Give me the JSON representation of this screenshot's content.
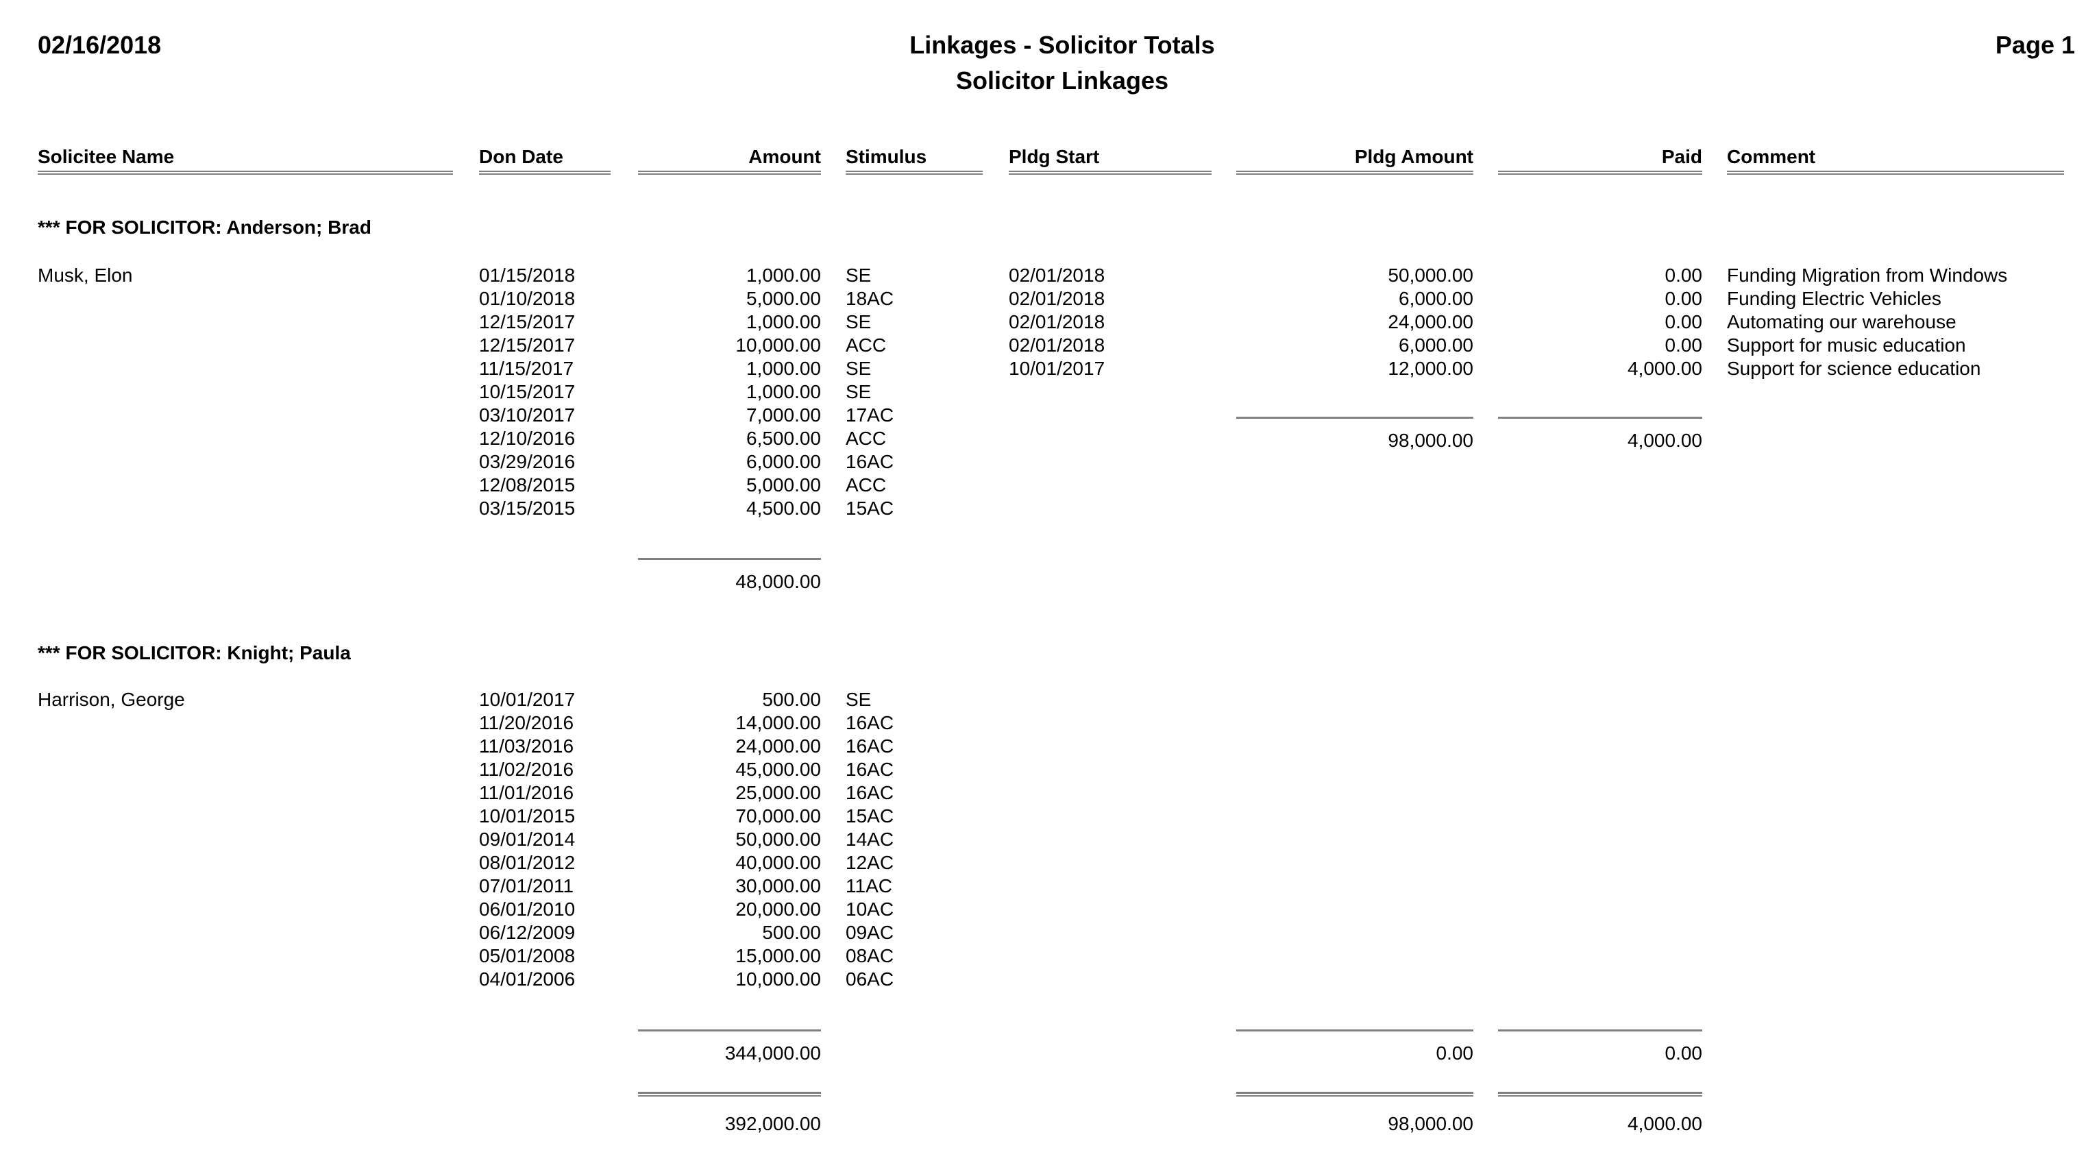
{
  "report": {
    "date": "02/16/2018",
    "title": "Linkages - Solicitor Totals",
    "subtitle": "Solicitor Linkages",
    "page": "Page 1"
  },
  "columns": {
    "solicitee_name": "Solicitee Name",
    "don_date": "Don Date",
    "amount": "Amount",
    "stimulus": "Stimulus",
    "pldg_start": "Pldg Start",
    "pldg_amount": "Pldg Amount",
    "paid": "Paid",
    "comment": "Comment"
  },
  "sections": [
    {
      "heading": "*** FOR SOLICITOR: Anderson; Brad",
      "solicitee": "Musk, Elon",
      "donations": [
        {
          "date": "01/15/2018",
          "amount": "1,000.00",
          "stimulus": "SE"
        },
        {
          "date": "01/10/2018",
          "amount": "5,000.00",
          "stimulus": "18AC"
        },
        {
          "date": "12/15/2017",
          "amount": "1,000.00",
          "stimulus": "SE"
        },
        {
          "date": "12/15/2017",
          "amount": "10,000.00",
          "stimulus": "ACC"
        },
        {
          "date": "11/15/2017",
          "amount": "1,000.00",
          "stimulus": "SE"
        },
        {
          "date": "10/15/2017",
          "amount": "1,000.00",
          "stimulus": "SE"
        },
        {
          "date": "03/10/2017",
          "amount": "7,000.00",
          "stimulus": "17AC"
        },
        {
          "date": "12/10/2016",
          "amount": "6,500.00",
          "stimulus": "ACC"
        },
        {
          "date": "03/29/2016",
          "amount": "6,000.00",
          "stimulus": "16AC"
        },
        {
          "date": "12/08/2015",
          "amount": "5,000.00",
          "stimulus": "ACC"
        },
        {
          "date": "03/15/2015",
          "amount": "4,500.00",
          "stimulus": "15AC"
        }
      ],
      "pledges": [
        {
          "start": "02/01/2018",
          "amount": "50,000.00",
          "paid": "0.00",
          "comment": "Funding Migration from Windows"
        },
        {
          "start": "02/01/2018",
          "amount": "6,000.00",
          "paid": "0.00",
          "comment": "Funding Electric Vehicles"
        },
        {
          "start": "02/01/2018",
          "amount": "24,000.00",
          "paid": "0.00",
          "comment": "Automating our warehouse"
        },
        {
          "start": "02/01/2018",
          "amount": "6,000.00",
          "paid": "0.00",
          "comment": "Support for music education"
        },
        {
          "start": "10/01/2017",
          "amount": "12,000.00",
          "paid": "4,000.00",
          "comment": "Support for science education"
        }
      ],
      "pledge_total": "98,000.00",
      "paid_total": "4,000.00",
      "amount_total": "48,000.00"
    },
    {
      "heading": "*** FOR SOLICITOR: Knight; Paula",
      "solicitee": "Harrison, George",
      "donations": [
        {
          "date": "10/01/2017",
          "amount": "500.00",
          "stimulus": "SE"
        },
        {
          "date": "11/20/2016",
          "amount": "14,000.00",
          "stimulus": "16AC"
        },
        {
          "date": "11/03/2016",
          "amount": "24,000.00",
          "stimulus": "16AC"
        },
        {
          "date": "11/02/2016",
          "amount": "45,000.00",
          "stimulus": "16AC"
        },
        {
          "date": "11/01/2016",
          "amount": "25,000.00",
          "stimulus": "16AC"
        },
        {
          "date": "10/01/2015",
          "amount": "70,000.00",
          "stimulus": "15AC"
        },
        {
          "date": "09/01/2014",
          "amount": "50,000.00",
          "stimulus": "14AC"
        },
        {
          "date": "08/01/2012",
          "amount": "40,000.00",
          "stimulus": "12AC"
        },
        {
          "date": "07/01/2011",
          "amount": "30,000.00",
          "stimulus": "11AC"
        },
        {
          "date": "06/01/2010",
          "amount": "20,000.00",
          "stimulus": "10AC"
        },
        {
          "date": "06/12/2009",
          "amount": "500.00",
          "stimulus": "09AC"
        },
        {
          "date": "05/01/2008",
          "amount": "15,000.00",
          "stimulus": "08AC"
        },
        {
          "date": "04/01/2006",
          "amount": "10,000.00",
          "stimulus": "06AC"
        }
      ],
      "pledges": [],
      "amount_total": "344,000.00",
      "pledge_total": "0.00",
      "paid_total": "0.00"
    }
  ],
  "grand_totals": {
    "amount": "392,000.00",
    "pledge_amount": "98,000.00",
    "paid": "4,000.00"
  }
}
